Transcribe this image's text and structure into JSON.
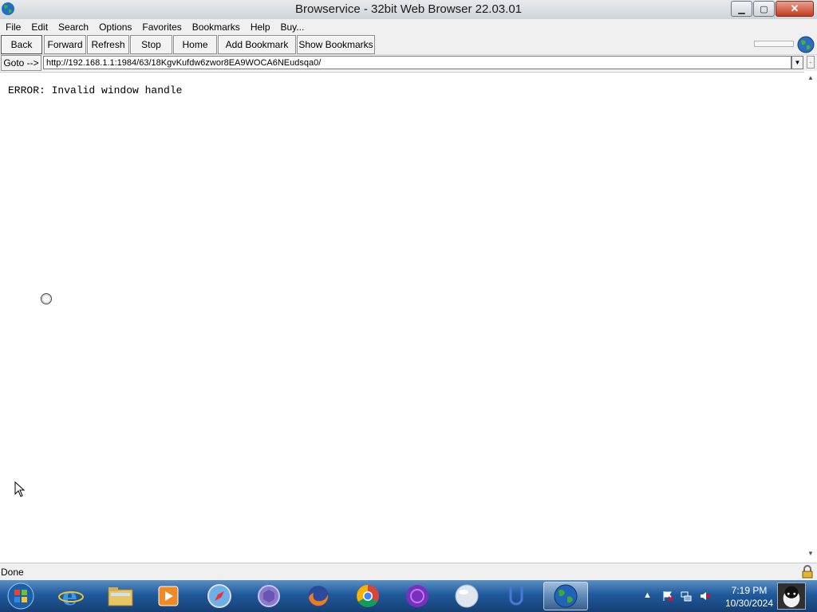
{
  "window": {
    "title": "Browservice - 32bit Web Browser 22.03.01",
    "controls": {
      "minimize": "▁",
      "maximize": "▢",
      "close": "✕"
    }
  },
  "menu": [
    "File",
    "Edit",
    "Search",
    "Options",
    "Favorites",
    "Bookmarks",
    "Help",
    "Buy..."
  ],
  "toolbar": {
    "back": "Back",
    "forward": "Forward",
    "refresh": "Refresh",
    "stop": "Stop",
    "home": "Home",
    "add_bookmark": "Add Bookmark",
    "show_bookmarks": "Show Bookmarks"
  },
  "address": {
    "goto_label": "Goto -->",
    "url": "http://192.168.1.1:1984/63/18KgvKufdw6zwor8EA9WOCA6NEudsqa0/"
  },
  "content": {
    "error_text": "ERROR: Invalid window handle"
  },
  "status": {
    "text": "Done"
  },
  "taskbar": {
    "apps": [
      "start-orb",
      "internet-explorer-icon",
      "file-explorer-icon",
      "media-player-icon",
      "safari-icon",
      "generic-app-icon",
      "firefox-icon",
      "chrome-icon",
      "purple-app-icon",
      "white-orb-icon",
      "u-app-icon",
      "globe-browser-icon"
    ],
    "clock_time": "7:19 PM",
    "clock_date": "10/30/2024"
  },
  "colors": {
    "taskbar_top": "#5b8fc4",
    "taskbar_bottom": "#163f73",
    "window_chrome": "#f0f0f0",
    "close_button": "#c43b1c"
  }
}
